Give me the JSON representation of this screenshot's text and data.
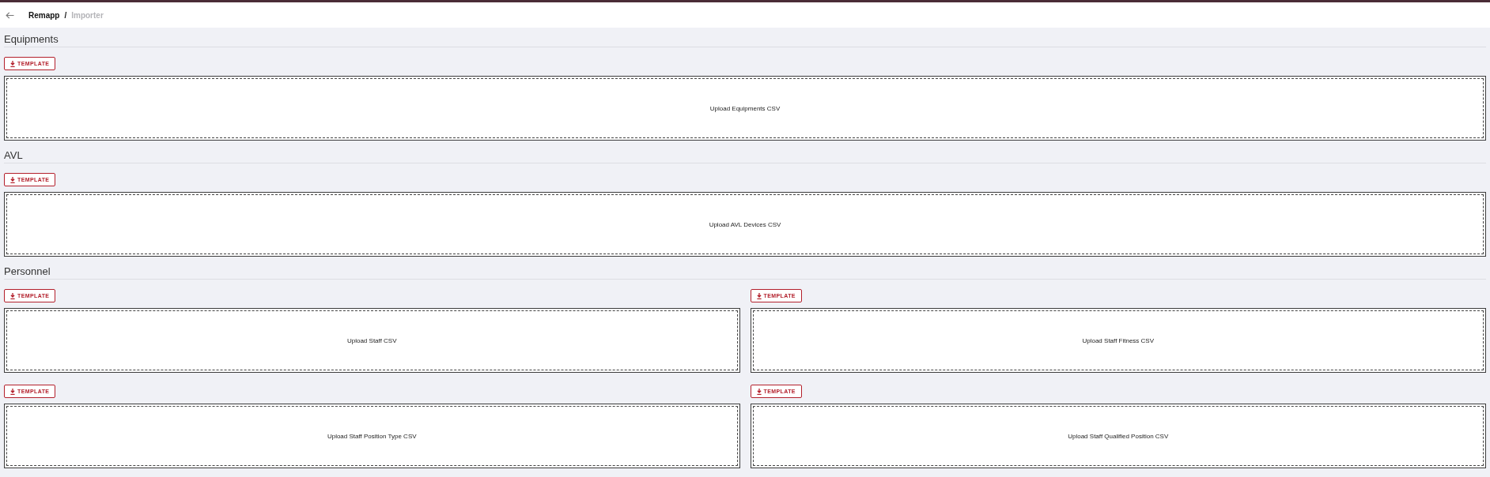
{
  "header": {
    "breadcrumb": [
      {
        "label": "Remapp",
        "current": false
      },
      {
        "label": "Importer",
        "current": true
      }
    ],
    "separator": "/"
  },
  "sections": [
    {
      "title": "Equipments",
      "uploads": [
        {
          "button": "TEMPLATE",
          "dropzone": "Upload Equipments CSV"
        }
      ]
    },
    {
      "title": "AVL",
      "uploads": [
        {
          "button": "TEMPLATE",
          "dropzone": "Upload AVL Devices CSV"
        }
      ]
    },
    {
      "title": "Personnel",
      "uploads": [
        {
          "button": "TEMPLATE",
          "dropzone": "Upload Staff CSV"
        },
        {
          "button": "TEMPLATE",
          "dropzone": "Upload Staff Fitness CSV"
        },
        {
          "button": "TEMPLATE",
          "dropzone": "Upload Staff Position Type CSV"
        },
        {
          "button": "TEMPLATE",
          "dropzone": "Upload Staff Qualified Position CSV"
        }
      ]
    }
  ]
}
